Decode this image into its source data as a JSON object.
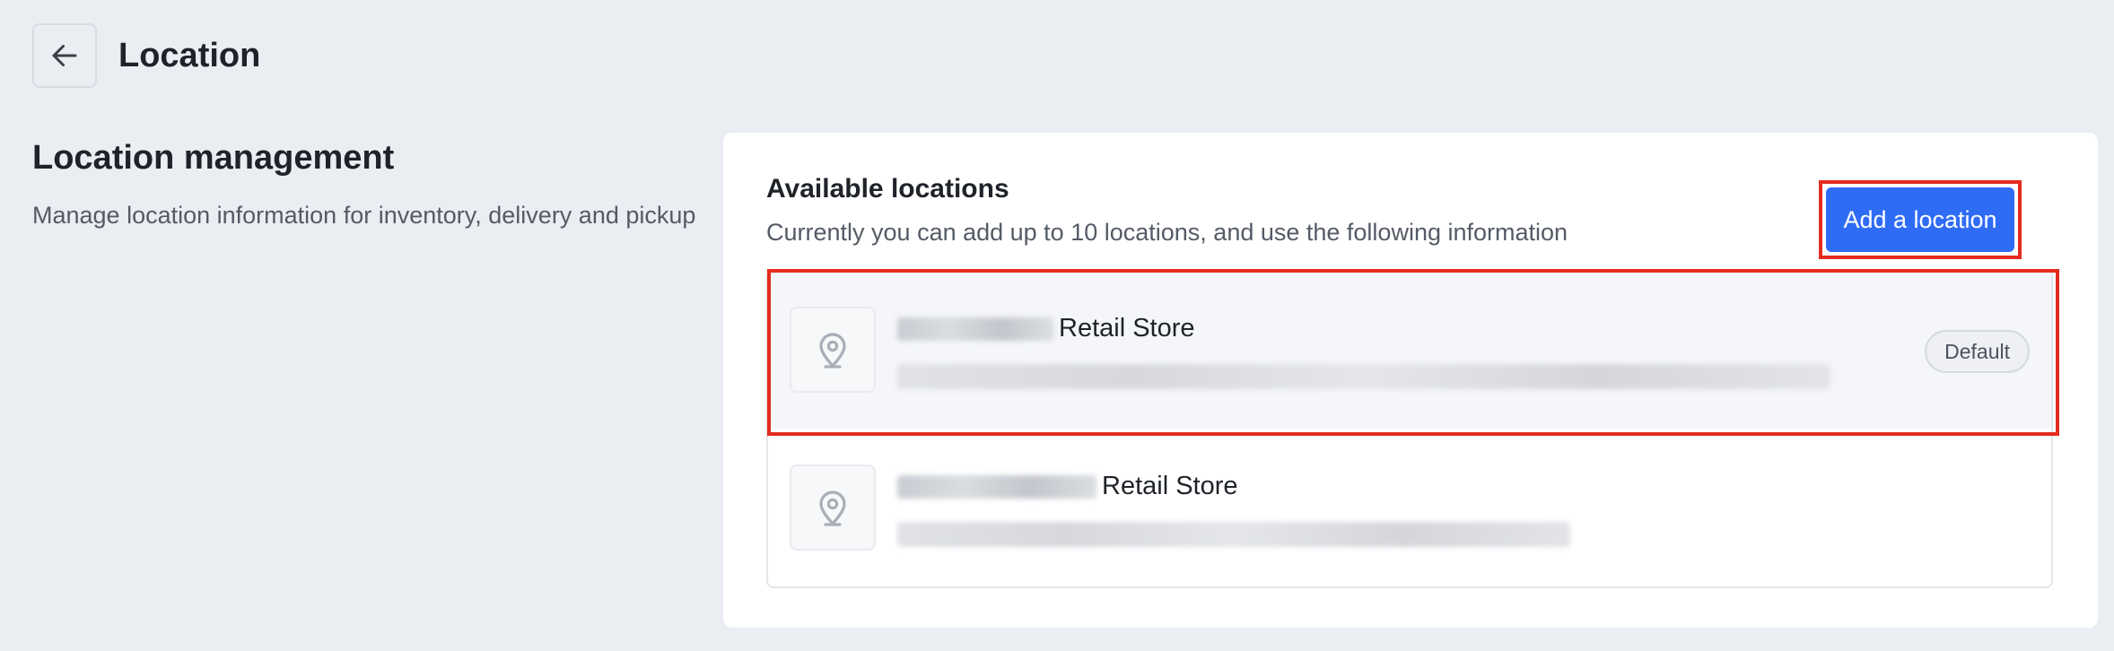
{
  "header": {
    "title": "Location",
    "back_icon": "arrow-left-icon"
  },
  "left": {
    "title": "Location management",
    "description": "Manage location information for inventory, delivery and pickup"
  },
  "card": {
    "title": "Available locations",
    "description": "Currently you can add up to 10 locations, and use the following information",
    "add_button_label": "Add a location",
    "accent_color": "#2f6cf6",
    "highlight_color": "#e32c1e"
  },
  "locations": [
    {
      "name_suffix": "Retail Store",
      "badge": "Default",
      "icon": "map-pin-icon"
    },
    {
      "name_suffix": "Retail Store",
      "icon": "map-pin-icon"
    }
  ]
}
